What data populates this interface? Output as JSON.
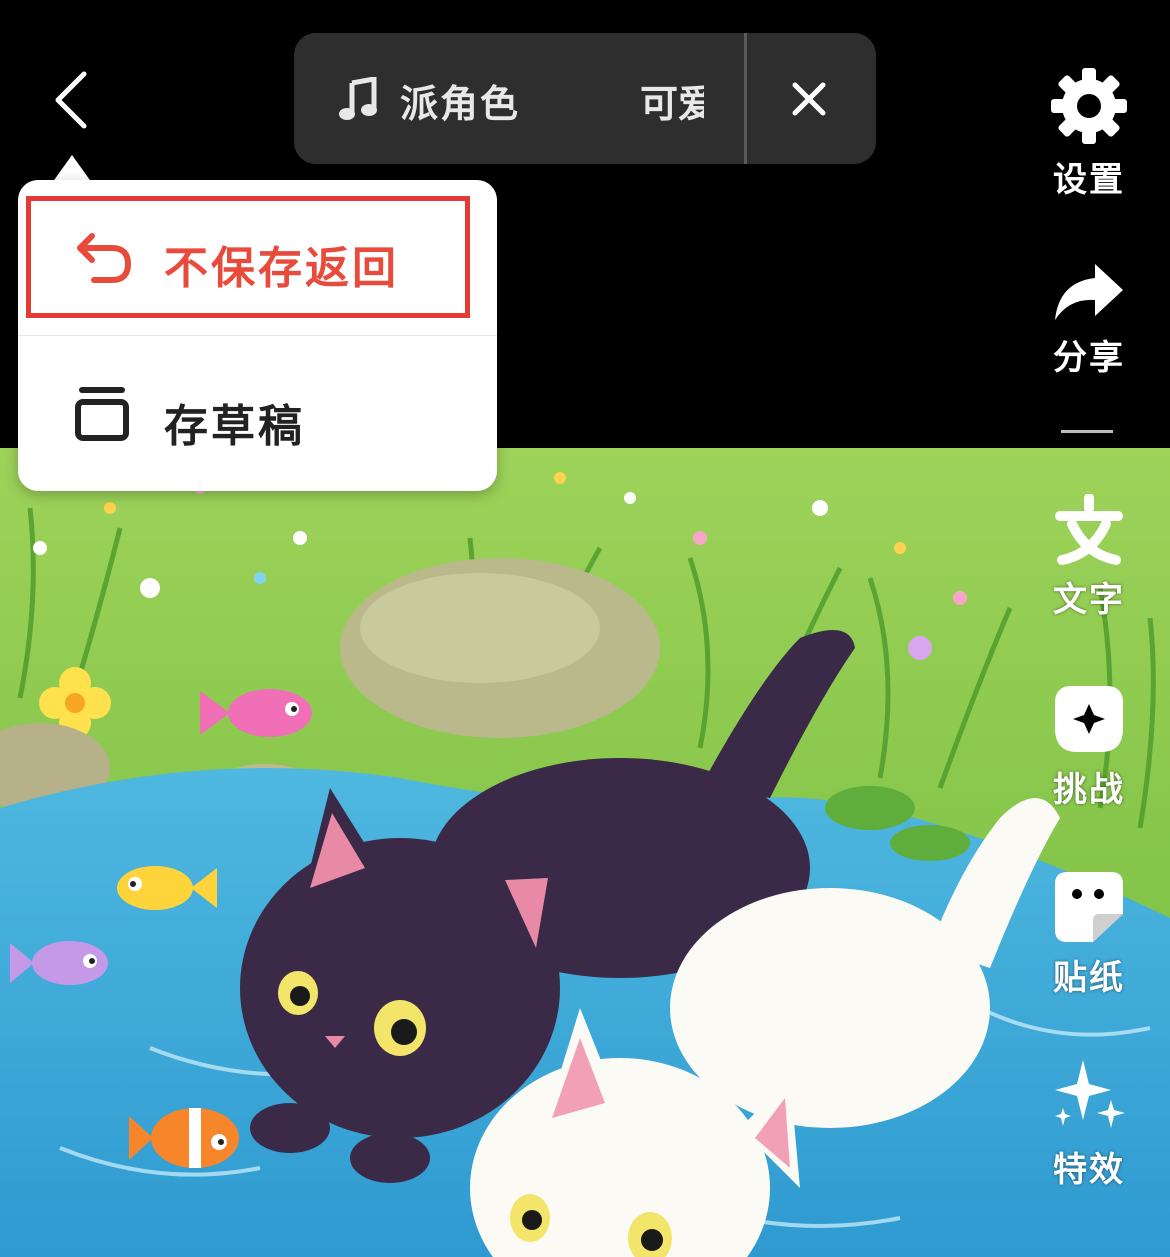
{
  "top_bar": {
    "music_title": "派角色",
    "music_scrolling_text": "可爱"
  },
  "right_toolbar": {
    "settings_label": "设置",
    "share_label": "分享",
    "text_label": "文字",
    "challenge_label": "挑战",
    "sticker_label": "贴纸",
    "effects_label": "特效"
  },
  "exit_menu": {
    "discard_label": "不保存返回",
    "draft_label": "存草稿"
  },
  "colors": {
    "accent_red": "#e84a3b",
    "highlight_border": "#e53935",
    "pill_bg": "#2e2e2e"
  },
  "icons": {
    "back": "chevron-left-icon",
    "music": "music-note-icon",
    "close": "close-icon",
    "settings": "gear-icon",
    "share": "share-arrow-icon",
    "text": "text-icon",
    "challenge": "challenge-icon",
    "sticker": "sticker-icon",
    "effects": "sparkle-icon",
    "discard": "undo-icon",
    "draft": "draft-box-icon"
  }
}
